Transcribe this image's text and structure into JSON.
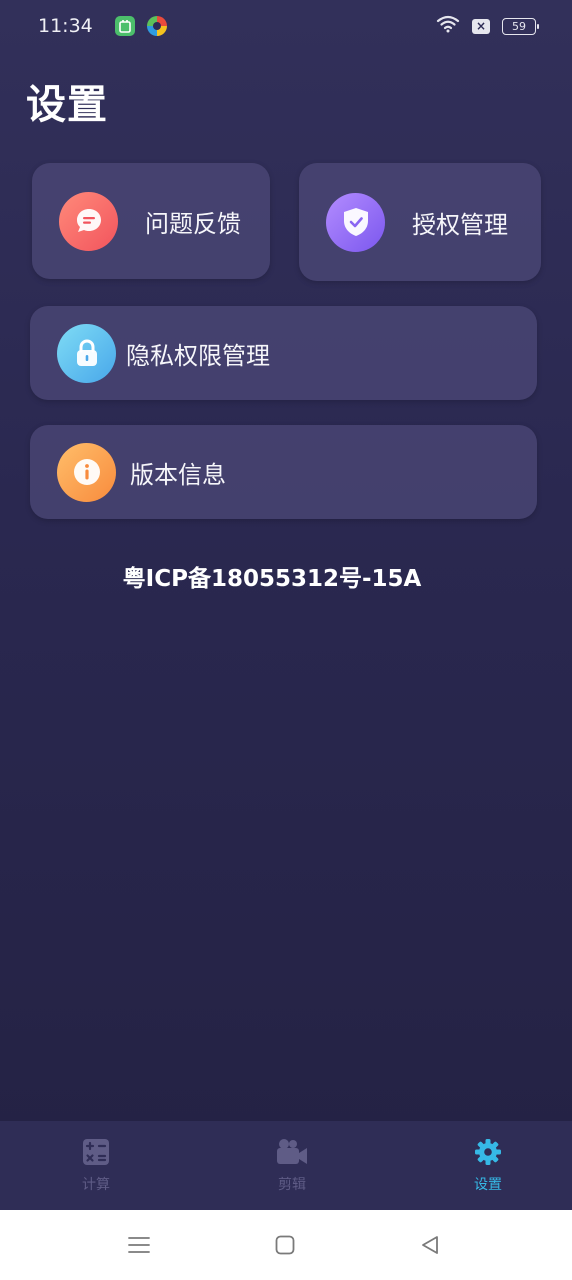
{
  "status_bar": {
    "time": "11:34",
    "battery_level": "59",
    "sim_icon_text": "×",
    "icons": [
      "app-badge-icon",
      "colorful-app-icon",
      "wifi-icon",
      "sim-off-icon",
      "battery-icon"
    ]
  },
  "page": {
    "title": "设置"
  },
  "cards": {
    "feedback": {
      "label": "问题反馈",
      "icon": "chat-bubble-icon"
    },
    "authorization": {
      "label": "授权管理",
      "icon": "shield-check-icon"
    },
    "privacy": {
      "label": "隐私权限管理",
      "icon": "lock-icon"
    },
    "version": {
      "label": "版本信息",
      "icon": "info-icon"
    }
  },
  "footer": {
    "icp": "粤ICP备18055312号-15A"
  },
  "tab_bar": {
    "items": [
      {
        "label": "计算",
        "icon": "calculator-icon",
        "active": false
      },
      {
        "label": "剪辑",
        "icon": "video-camera-icon",
        "active": false
      },
      {
        "label": "设置",
        "icon": "gear-icon",
        "active": true
      }
    ]
  },
  "colors": {
    "background_top": "#32305a",
    "background_bottom": "#232142",
    "card": "#4e4a78",
    "active_tab": "#36b9e6",
    "inactive_tab": "#5f5c86"
  },
  "nav_bar": {
    "buttons": [
      "menu-icon",
      "home-icon",
      "back-icon"
    ]
  }
}
